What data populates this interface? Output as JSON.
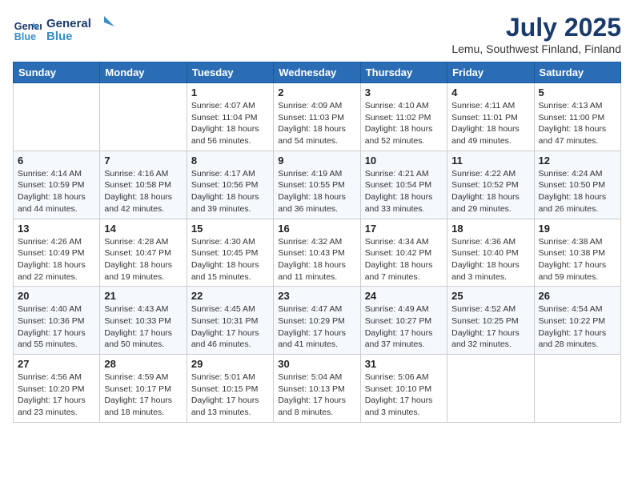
{
  "header": {
    "logo_line1": "General",
    "logo_line2": "Blue",
    "title": "July 2025",
    "subtitle": "Lemu, Southwest Finland, Finland"
  },
  "days_of_week": [
    "Sunday",
    "Monday",
    "Tuesday",
    "Wednesday",
    "Thursday",
    "Friday",
    "Saturday"
  ],
  "weeks": [
    [
      {
        "day": "",
        "detail": ""
      },
      {
        "day": "",
        "detail": ""
      },
      {
        "day": "1",
        "detail": "Sunrise: 4:07 AM\nSunset: 11:04 PM\nDaylight: 18 hours and 56 minutes."
      },
      {
        "day": "2",
        "detail": "Sunrise: 4:09 AM\nSunset: 11:03 PM\nDaylight: 18 hours and 54 minutes."
      },
      {
        "day": "3",
        "detail": "Sunrise: 4:10 AM\nSunset: 11:02 PM\nDaylight: 18 hours and 52 minutes."
      },
      {
        "day": "4",
        "detail": "Sunrise: 4:11 AM\nSunset: 11:01 PM\nDaylight: 18 hours and 49 minutes."
      },
      {
        "day": "5",
        "detail": "Sunrise: 4:13 AM\nSunset: 11:00 PM\nDaylight: 18 hours and 47 minutes."
      }
    ],
    [
      {
        "day": "6",
        "detail": "Sunrise: 4:14 AM\nSunset: 10:59 PM\nDaylight: 18 hours and 44 minutes."
      },
      {
        "day": "7",
        "detail": "Sunrise: 4:16 AM\nSunset: 10:58 PM\nDaylight: 18 hours and 42 minutes."
      },
      {
        "day": "8",
        "detail": "Sunrise: 4:17 AM\nSunset: 10:56 PM\nDaylight: 18 hours and 39 minutes."
      },
      {
        "day": "9",
        "detail": "Sunrise: 4:19 AM\nSunset: 10:55 PM\nDaylight: 18 hours and 36 minutes."
      },
      {
        "day": "10",
        "detail": "Sunrise: 4:21 AM\nSunset: 10:54 PM\nDaylight: 18 hours and 33 minutes."
      },
      {
        "day": "11",
        "detail": "Sunrise: 4:22 AM\nSunset: 10:52 PM\nDaylight: 18 hours and 29 minutes."
      },
      {
        "day": "12",
        "detail": "Sunrise: 4:24 AM\nSunset: 10:50 PM\nDaylight: 18 hours and 26 minutes."
      }
    ],
    [
      {
        "day": "13",
        "detail": "Sunrise: 4:26 AM\nSunset: 10:49 PM\nDaylight: 18 hours and 22 minutes."
      },
      {
        "day": "14",
        "detail": "Sunrise: 4:28 AM\nSunset: 10:47 PM\nDaylight: 18 hours and 19 minutes."
      },
      {
        "day": "15",
        "detail": "Sunrise: 4:30 AM\nSunset: 10:45 PM\nDaylight: 18 hours and 15 minutes."
      },
      {
        "day": "16",
        "detail": "Sunrise: 4:32 AM\nSunset: 10:43 PM\nDaylight: 18 hours and 11 minutes."
      },
      {
        "day": "17",
        "detail": "Sunrise: 4:34 AM\nSunset: 10:42 PM\nDaylight: 18 hours and 7 minutes."
      },
      {
        "day": "18",
        "detail": "Sunrise: 4:36 AM\nSunset: 10:40 PM\nDaylight: 18 hours and 3 minutes."
      },
      {
        "day": "19",
        "detail": "Sunrise: 4:38 AM\nSunset: 10:38 PM\nDaylight: 17 hours and 59 minutes."
      }
    ],
    [
      {
        "day": "20",
        "detail": "Sunrise: 4:40 AM\nSunset: 10:36 PM\nDaylight: 17 hours and 55 minutes."
      },
      {
        "day": "21",
        "detail": "Sunrise: 4:43 AM\nSunset: 10:33 PM\nDaylight: 17 hours and 50 minutes."
      },
      {
        "day": "22",
        "detail": "Sunrise: 4:45 AM\nSunset: 10:31 PM\nDaylight: 17 hours and 46 minutes."
      },
      {
        "day": "23",
        "detail": "Sunrise: 4:47 AM\nSunset: 10:29 PM\nDaylight: 17 hours and 41 minutes."
      },
      {
        "day": "24",
        "detail": "Sunrise: 4:49 AM\nSunset: 10:27 PM\nDaylight: 17 hours and 37 minutes."
      },
      {
        "day": "25",
        "detail": "Sunrise: 4:52 AM\nSunset: 10:25 PM\nDaylight: 17 hours and 32 minutes."
      },
      {
        "day": "26",
        "detail": "Sunrise: 4:54 AM\nSunset: 10:22 PM\nDaylight: 17 hours and 28 minutes."
      }
    ],
    [
      {
        "day": "27",
        "detail": "Sunrise: 4:56 AM\nSunset: 10:20 PM\nDaylight: 17 hours and 23 minutes."
      },
      {
        "day": "28",
        "detail": "Sunrise: 4:59 AM\nSunset: 10:17 PM\nDaylight: 17 hours and 18 minutes."
      },
      {
        "day": "29",
        "detail": "Sunrise: 5:01 AM\nSunset: 10:15 PM\nDaylight: 17 hours and 13 minutes."
      },
      {
        "day": "30",
        "detail": "Sunrise: 5:04 AM\nSunset: 10:13 PM\nDaylight: 17 hours and 8 minutes."
      },
      {
        "day": "31",
        "detail": "Sunrise: 5:06 AM\nSunset: 10:10 PM\nDaylight: 17 hours and 3 minutes."
      },
      {
        "day": "",
        "detail": ""
      },
      {
        "day": "",
        "detail": ""
      }
    ]
  ]
}
